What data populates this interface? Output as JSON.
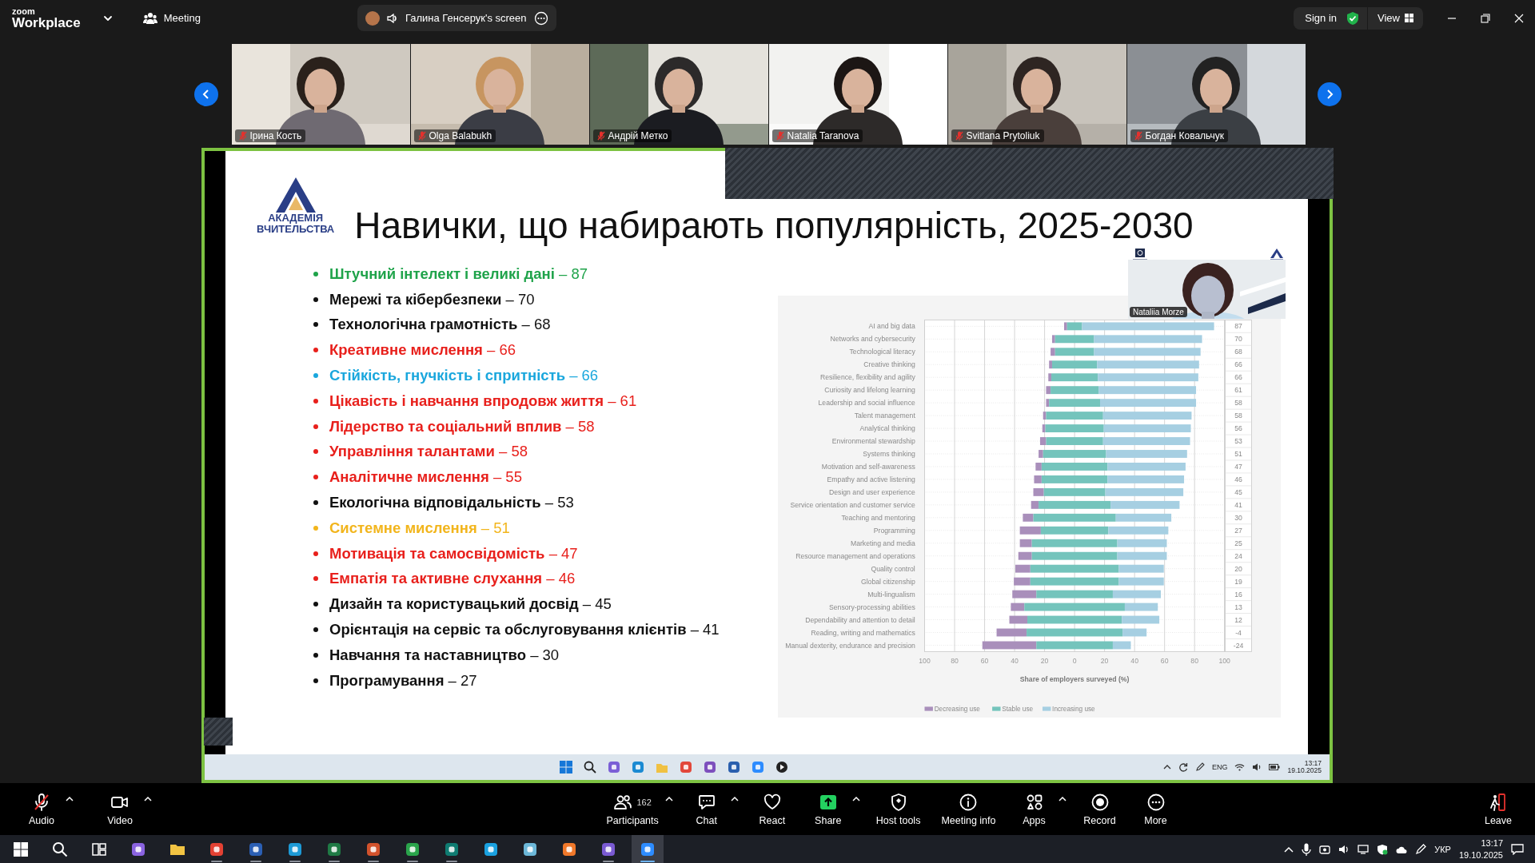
{
  "topbar": {
    "logo_small": "zoom",
    "logo": "Workplace",
    "meeting": "Meeting",
    "share_tab": "Галина Генсерук's screen",
    "sign_in": "Sign in",
    "view": "View"
  },
  "gallery": [
    {
      "name": "Ірина Кость",
      "muted": true
    },
    {
      "name": "Olga Balabukh",
      "muted": true
    },
    {
      "name": "Андрій Метко",
      "muted": true
    },
    {
      "name": "Natalia Taranova",
      "muted": true
    },
    {
      "name": "Svitlana Prytoliuk",
      "muted": true
    },
    {
      "name": "Богдан Ковальчук",
      "muted": true
    }
  ],
  "slide": {
    "logo_lines": [
      "АКАДЕМІЯ",
      "ВЧИТЕЛЬСТВА"
    ],
    "title": "Навички, що набирають популярність, 2025-2030",
    "skills": [
      {
        "text": "**Штучний інтелект і великі дані** – 87",
        "color": "#1fa34a"
      },
      {
        "text": "**Мережі та кібербезпеки** – 70",
        "color": "#111111"
      },
      {
        "text": "**Технологічна грамотність** – 68",
        "color": "#111111"
      },
      {
        "text": "**Креативне мислення** – 66",
        "color": "#e8201c"
      },
      {
        "text": "**Стійкість, гнучкість і спритність** – 66",
        "color": "#1aa7dd"
      },
      {
        "text": "**Цікавість і навчання впродовж життя** – 61",
        "color": "#e8201c"
      },
      {
        "text": "**Лідерство та соціальний вплив** – 58",
        "color": "#e8201c"
      },
      {
        "text": "**Управління талантами** – 58",
        "color": "#e8201c"
      },
      {
        "text": "**Аналітичне мислення** – 55",
        "color": "#e8201c"
      },
      {
        "text": "**Екологічна відповідальність** – 53",
        "color": "#111111"
      },
      {
        "text": "**Системне мислення** – 51",
        "color": "#f2b51c"
      },
      {
        "text": "**Мотивація та самосвідомість** – 47",
        "color": "#e8201c"
      },
      {
        "text": "**Емпатія та активне слухання** – 46",
        "color": "#e8201c"
      },
      {
        "text": "**Дизайн та користувацький досвід** – 45",
        "color": "#111111"
      },
      {
        "text": "**Орієнтація на сервіс та обслуговування клієнтів** – 41",
        "color": "#111111"
      },
      {
        "text": "**Навчання та наставництво** – 30",
        "color": "#111111"
      },
      {
        "text": "**Програмування** – 27",
        "color": "#111111"
      }
    ],
    "chart_panel": {
      "axis_title": "Share of employers surveyed (%)",
      "categories": [
        "AI and big data",
        "Networks and cybersecurity",
        "Technological literacy",
        "Creative thinking",
        "Resilience, flexibility and agility",
        "Curiosity and lifelong learning",
        "Leadership and social influence",
        "Talent management",
        "Analytical thinking",
        "Environmental stewardship",
        "Systems thinking",
        "Motivation and self-awareness",
        "Empathy and active listening",
        "Design and user experience",
        "Service orientation and customer service",
        "Teaching and mentoring",
        "Programming",
        "Marketing and media",
        "Resource management and operations",
        "Quality control",
        "Global citizenship",
        "Multi-lingualism",
        "Sensory-processing abilities",
        "Dependability and attention to detail",
        "Reading, writing and mathematics",
        "Manual dexterity, endurance and precision"
      ],
      "legend": [
        {
          "label": "Decreasing use",
          "color": "#a98fbb"
        },
        {
          "label": "Stable use",
          "color": "#74c4bc"
        },
        {
          "label": "Increasing use",
          "color": "#a6cfe2"
        }
      ],
      "tick_labels": [
        "100",
        "80",
        "60",
        "40",
        "20",
        "0",
        "20",
        "40",
        "60",
        "80",
        "100"
      ],
      "net_values": [
        "87",
        "70",
        "68",
        "66",
        "66",
        "61",
        "58",
        "58",
        "56",
        "53",
        "51",
        "47",
        "46",
        "45",
        "41",
        "30",
        "27",
        "25",
        "24",
        "20",
        "19",
        "16",
        "13",
        "12",
        "-4",
        "-24"
      ]
    },
    "speaker": {
      "name": "Nataliia Morze"
    }
  },
  "shared_taskbar": {
    "language": "ENG",
    "time": "13:17",
    "date": "19.10.2025"
  },
  "toolbar": [
    {
      "kind": "audio",
      "label": "Audio",
      "muted": true,
      "menu": true
    },
    {
      "kind": "video",
      "label": "Video",
      "menu": true
    },
    {
      "kind": "participants",
      "label": "Participants",
      "count": "162",
      "menu": true
    },
    {
      "kind": "chat",
      "label": "Chat",
      "menu": true
    },
    {
      "kind": "react",
      "label": "React",
      "menu": false
    },
    {
      "kind": "share",
      "label": "Share",
      "menu": true
    },
    {
      "kind": "host",
      "label": "Host tools",
      "menu": false
    },
    {
      "kind": "info",
      "label": "Meeting info",
      "menu": false
    },
    {
      "kind": "apps",
      "label": "Apps",
      "menu": true
    },
    {
      "kind": "record",
      "label": "Record",
      "menu": false
    },
    {
      "kind": "more",
      "label": "More",
      "menu": false
    },
    {
      "kind": "leave",
      "label": "Leave",
      "menu": false
    }
  ],
  "taskbar": {
    "apps": [
      {
        "active": false,
        "running": false
      },
      {
        "active": false,
        "running": false
      },
      {
        "active": false,
        "running": true
      },
      {
        "active": false,
        "running": true
      },
      {
        "active": false,
        "running": true
      },
      {
        "active": false,
        "running": true
      },
      {
        "active": false,
        "running": true
      },
      {
        "active": false,
        "running": true
      },
      {
        "active": false,
        "running": true
      },
      {
        "active": false,
        "running": false
      },
      {
        "active": false,
        "running": false
      },
      {
        "active": false,
        "running": false
      },
      {
        "active": false,
        "running": true
      },
      {
        "active": true,
        "running": true
      }
    ],
    "language": "УКР",
    "time": "13:17",
    "date": "19.10.2025"
  }
}
